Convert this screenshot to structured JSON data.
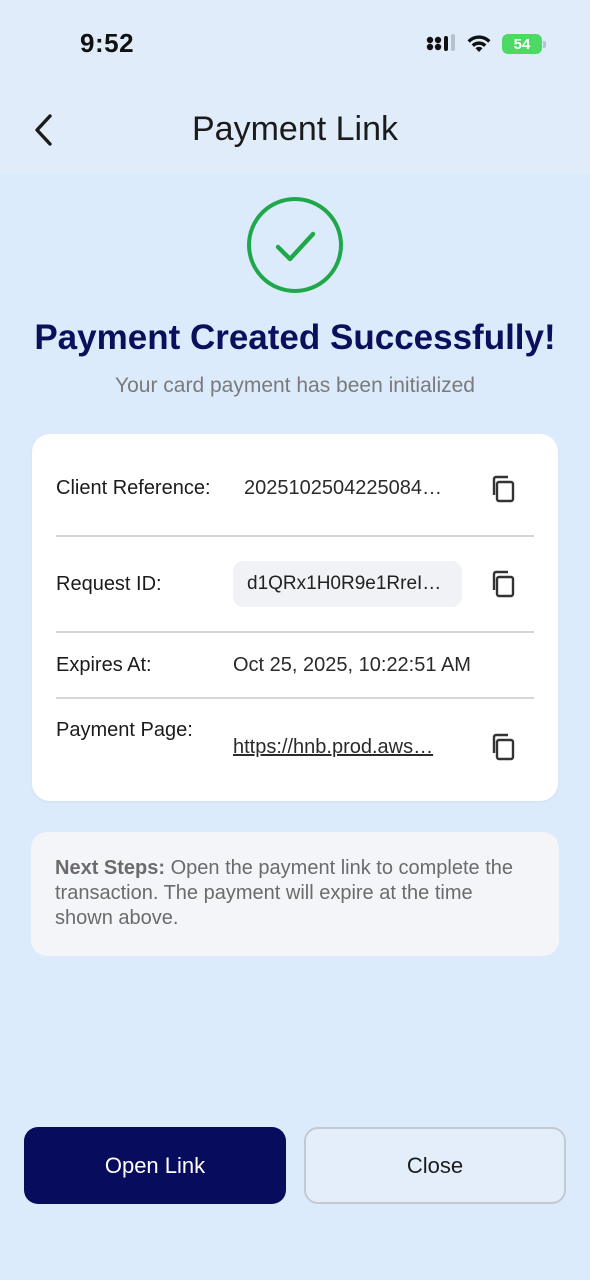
{
  "status_bar": {
    "time": "9:52",
    "battery": "54"
  },
  "header": {
    "title": "Payment Link"
  },
  "success": {
    "title": "Payment Created Successfully!",
    "subtitle": "Your card payment has been initialized"
  },
  "details": {
    "client_reference": {
      "label": "Client Reference:",
      "value": "2025102504225084…"
    },
    "request_id": {
      "label": "Request ID:",
      "value": "d1QRx1H0R9e1RreI…"
    },
    "expires_at": {
      "label": "Expires At:",
      "value": "Oct 25, 2025, 10:22:51 AM"
    },
    "payment_page": {
      "label": "Payment Page:",
      "value": "https://hnb.prod.aws…"
    }
  },
  "next_steps": {
    "label": "Next Steps:",
    "text": " Open the payment link to complete the transaction. The payment will expire at the time shown above."
  },
  "buttons": {
    "open_link": "Open Link",
    "close": "Close"
  },
  "colors": {
    "success_green": "#1fa84a",
    "navy": "#070c5c",
    "background": "#dcebfb"
  }
}
